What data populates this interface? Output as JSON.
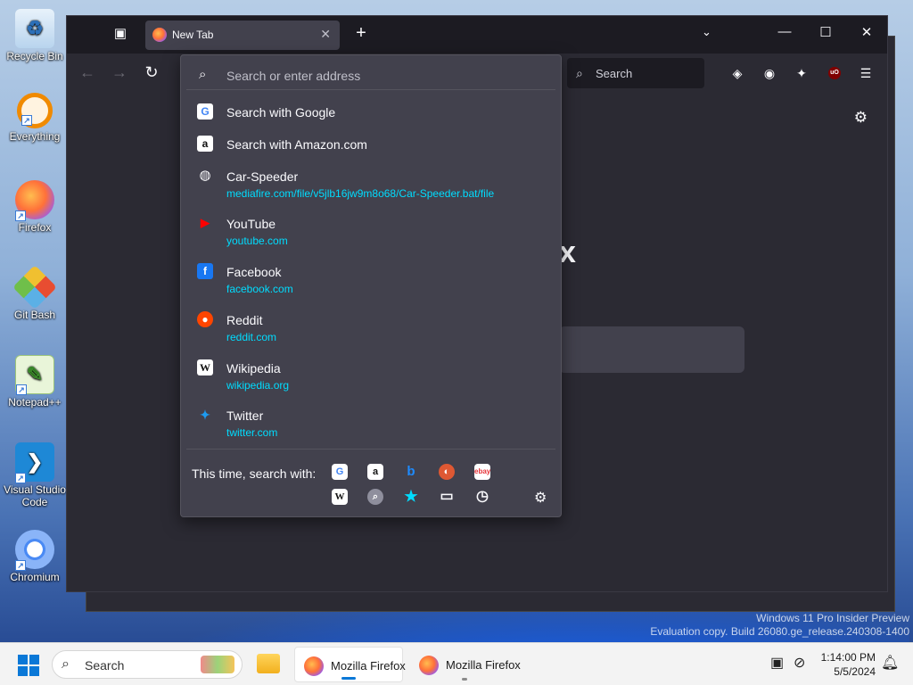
{
  "desktop": {
    "icons": [
      {
        "label": "Recycle Bin",
        "icon": "recycle-bin-icon"
      },
      {
        "label": "Everything",
        "icon": "everything-search-icon"
      },
      {
        "label": "Firefox",
        "icon": "firefox-icon"
      },
      {
        "label": "Git Bash",
        "icon": "git-bash-icon"
      },
      {
        "label": "Notepad++",
        "icon": "notepad-plus-plus-icon"
      },
      {
        "label": "Visual Studio Code",
        "icon": "vscode-icon"
      },
      {
        "label": "Chromium",
        "icon": "chromium-icon"
      }
    ],
    "watermark_line1": "Windows 11 Pro Insider Preview",
    "watermark_line2": "Evaluation copy. Build 26080.ge_release.240308-1400"
  },
  "browser": {
    "tab_title": "New Tab",
    "urlbar_placeholder": "Search or enter address",
    "search_placeholder": "Search",
    "brand_text_fragment": "x"
  },
  "dropdown": {
    "rows": [
      {
        "title": "Search with Google",
        "url": "",
        "icon": "google-icon"
      },
      {
        "title": "Search with Amazon.com",
        "url": "",
        "icon": "amazon-icon"
      },
      {
        "title": "Car-Speeder",
        "url": "mediafire.com/file/v5jlb16jw9m8o68/Car-Speeder.bat/file",
        "icon": "globe-icon"
      },
      {
        "title": "YouTube",
        "url": "youtube.com",
        "icon": "youtube-icon"
      },
      {
        "title": "Facebook",
        "url": "facebook.com",
        "icon": "facebook-icon"
      },
      {
        "title": "Reddit",
        "url": "reddit.com",
        "icon": "reddit-icon"
      },
      {
        "title": "Wikipedia",
        "url": "wikipedia.org",
        "icon": "wikipedia-icon"
      },
      {
        "title": "Twitter",
        "url": "twitter.com",
        "icon": "twitter-icon"
      }
    ],
    "oneoff_label": "This time, search with:",
    "oneoff_engines": [
      "google-icon",
      "amazon-icon",
      "bing-icon",
      "duckduckgo-icon",
      "ebay-icon",
      "wikipedia-icon",
      "search-engine-icon",
      "bookmarks-icon",
      "tabs-icon",
      "history-icon"
    ]
  },
  "taskbar": {
    "search_placeholder": "Search",
    "apps": [
      {
        "label": "Mozilla Firefox",
        "active": true
      },
      {
        "label": "Mozilla Firefox",
        "active": false
      }
    ],
    "time": "1:14:00 PM",
    "date": "5/5/2024"
  },
  "colors": {
    "accent_url": "#00ddff",
    "popup_bg": "#42414d",
    "toolbar_bg": "#2b2a33",
    "tabbar_bg": "#1c1b22",
    "windows_accent": "#0a78d7"
  }
}
